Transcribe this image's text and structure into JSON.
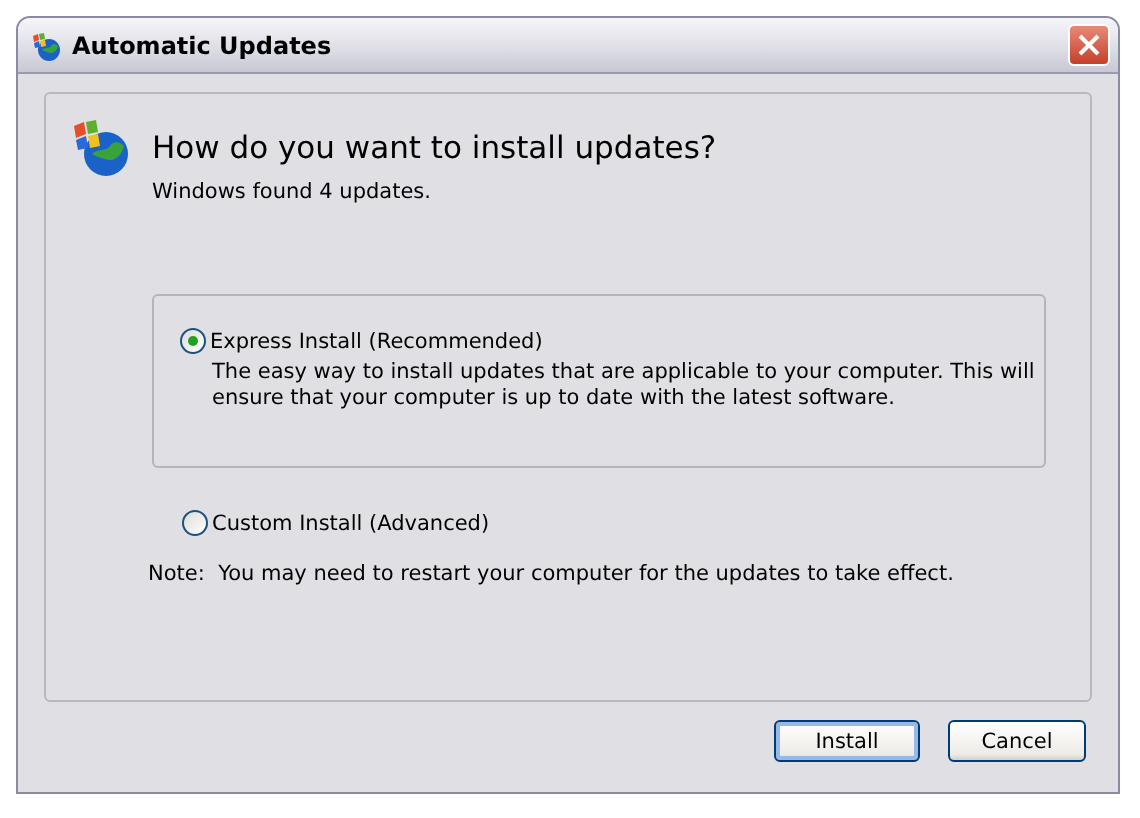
{
  "window": {
    "title": "Automatic Updates"
  },
  "heading": "How do you want to install updates?",
  "subheading": "Windows found 4 updates.",
  "options": [
    {
      "label": "Express Install (Recommended)",
      "selected": true,
      "description": "The easy way to install updates that are applicable to your computer. This will ensure that your computer is up to date with the latest software."
    },
    {
      "label": "Custom Install (Advanced)",
      "selected": false
    }
  ],
  "note": "Note:  You may need to restart your computer for the updates to take effect.",
  "buttons": [
    {
      "label": "Install",
      "default": true
    },
    {
      "label": "Cancel",
      "default": false
    }
  ]
}
